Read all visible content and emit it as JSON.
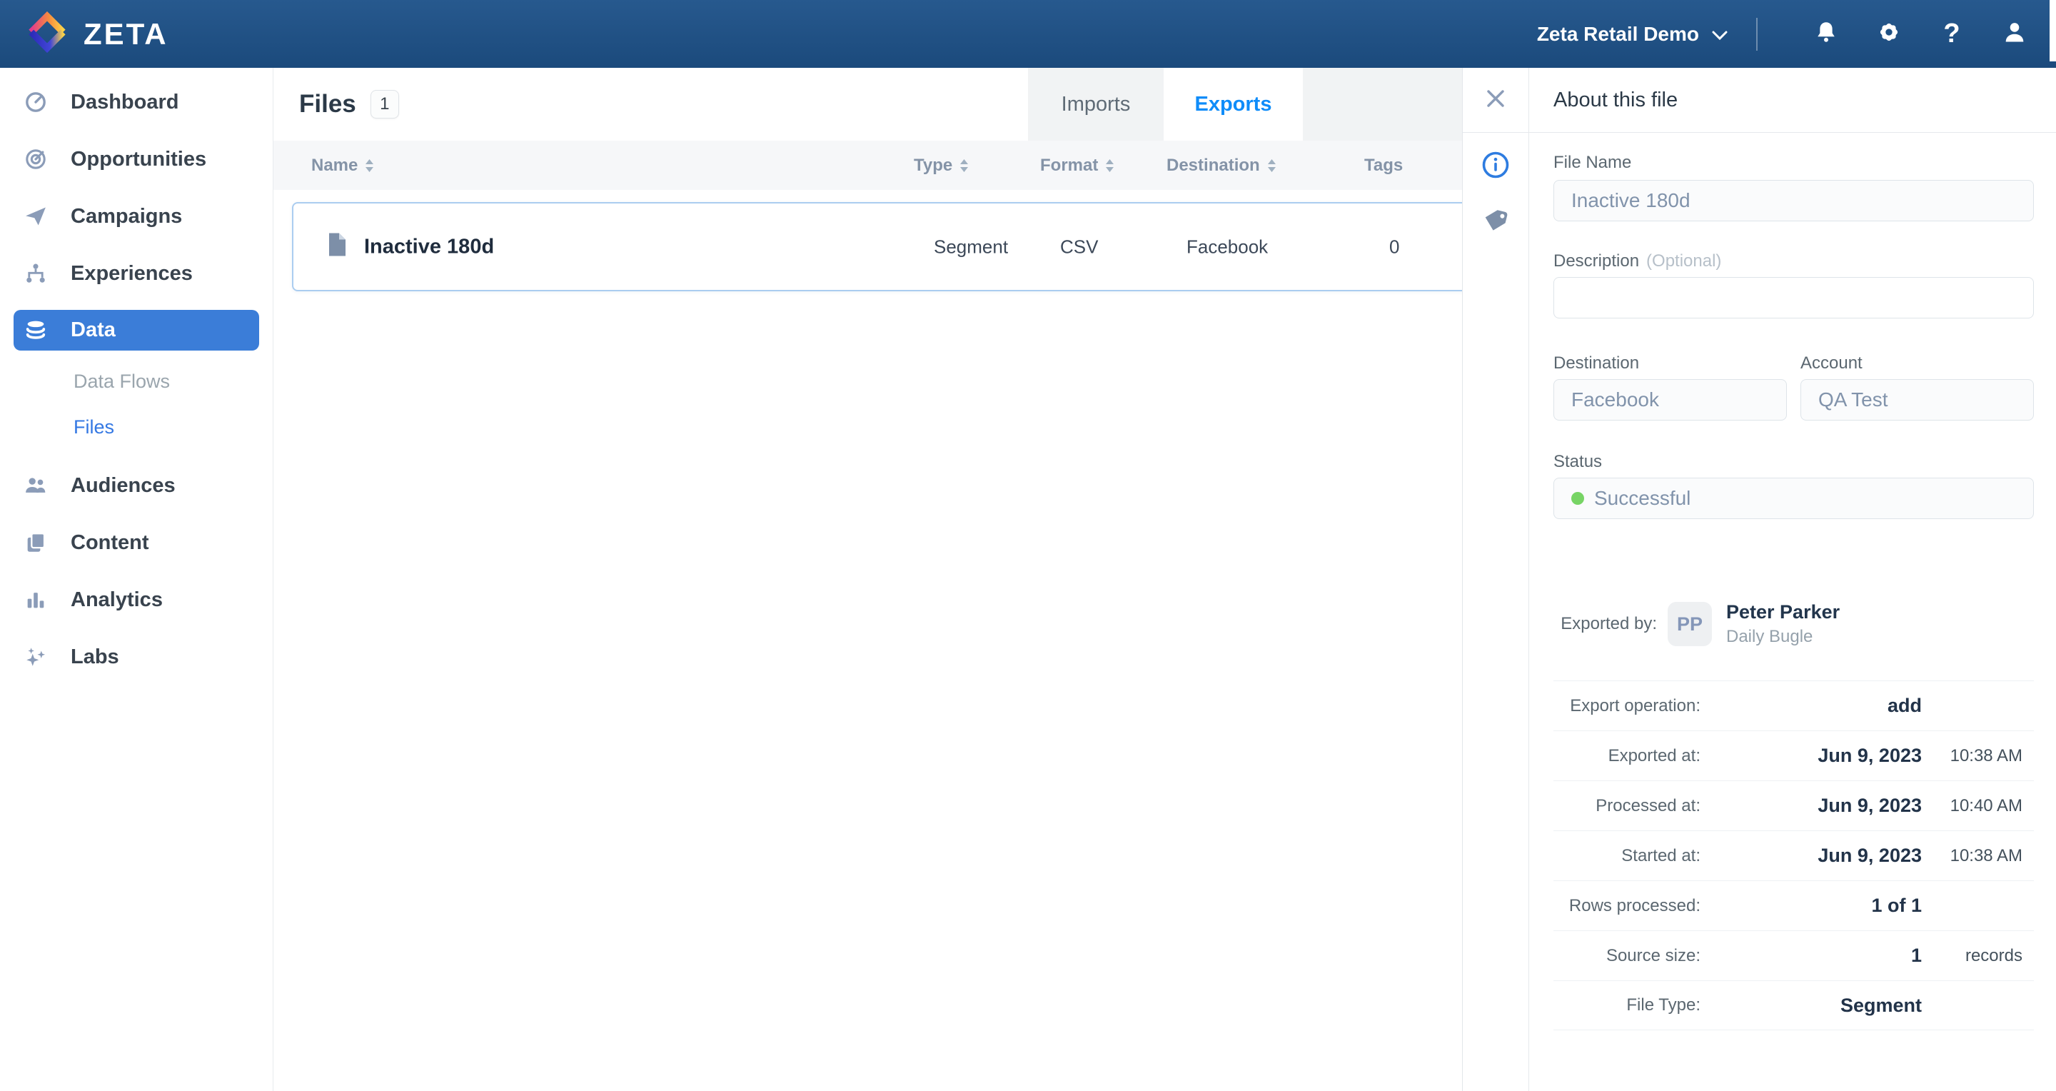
{
  "colors": {
    "navbar_blue": "#1e5083",
    "accent_blue": "#0f8cf9",
    "active_nav_blue": "#3b7dd8",
    "link_blue": "#3478e3",
    "success_green": "#77d465"
  },
  "navbar": {
    "brand": "ZETA",
    "account_selector": {
      "label": "Zeta Retail Demo",
      "icon": "chevron-down-icon"
    },
    "icons": [
      "bell-icon",
      "gear-icon",
      "help-icon",
      "user-icon"
    ],
    "help_glyph": "?"
  },
  "sidebar": {
    "items": [
      {
        "label": "Dashboard",
        "icon": "dashboard-icon"
      },
      {
        "label": "Opportunities",
        "icon": "opportunities-icon"
      },
      {
        "label": "Campaigns",
        "icon": "campaigns-icon"
      },
      {
        "label": "Experiences",
        "icon": "experiences-icon"
      },
      {
        "label": "Data",
        "icon": "data-icon",
        "active": true
      },
      {
        "label": "Audiences",
        "icon": "audiences-icon"
      },
      {
        "label": "Content",
        "icon": "content-icon"
      },
      {
        "label": "Analytics",
        "icon": "analytics-icon"
      },
      {
        "label": "Labs",
        "icon": "labs-icon"
      }
    ],
    "data_sub_items": [
      {
        "label": "Data Flows",
        "active": false
      },
      {
        "label": "Files",
        "active": true
      }
    ]
  },
  "main": {
    "title": "Files",
    "count_badge": "1",
    "tabs": [
      {
        "label": "Imports",
        "active": false
      },
      {
        "label": "Exports",
        "active": true
      }
    ],
    "table": {
      "columns": [
        {
          "label": "Name",
          "sortable": true
        },
        {
          "label": "Type",
          "sortable": true
        },
        {
          "label": "Format",
          "sortable": true
        },
        {
          "label": "Destination",
          "sortable": true
        },
        {
          "label": "Tags",
          "sortable": false
        }
      ],
      "rows": [
        {
          "name": "Inactive 180d",
          "type": "Segment",
          "format": "CSV",
          "destination": "Facebook",
          "tags": "0"
        }
      ]
    }
  },
  "panel": {
    "title": "About this file",
    "strip_icons": [
      "close-icon",
      "info-icon",
      "tag-icon"
    ],
    "file_name": {
      "label": "File Name",
      "value": "Inactive 180d"
    },
    "description": {
      "label": "Description",
      "hint": "(Optional)",
      "value": ""
    },
    "destination": {
      "label": "Destination",
      "value": "Facebook"
    },
    "account": {
      "label": "Account",
      "value": "QA Test"
    },
    "status": {
      "label": "Status",
      "value": "Successful"
    },
    "exported_by": {
      "label": "Exported by:",
      "initials": "PP",
      "name": "Peter Parker",
      "org": "Daily Bugle"
    },
    "details": [
      {
        "label": "Export operation:",
        "value": "add",
        "extra": ""
      },
      {
        "label": "Exported at:",
        "value": "Jun 9, 2023",
        "extra": "10:38 AM"
      },
      {
        "label": "Processed at:",
        "value": "Jun 9, 2023",
        "extra": "10:40 AM"
      },
      {
        "label": "Started at:",
        "value": "Jun 9, 2023",
        "extra": "10:38 AM"
      },
      {
        "label": "Rows processed:",
        "value": "1 of 1",
        "extra": ""
      },
      {
        "label": "Source size:",
        "value": "1",
        "extra": "records"
      },
      {
        "label": "File Type:",
        "value": "Segment",
        "extra": ""
      }
    ]
  }
}
